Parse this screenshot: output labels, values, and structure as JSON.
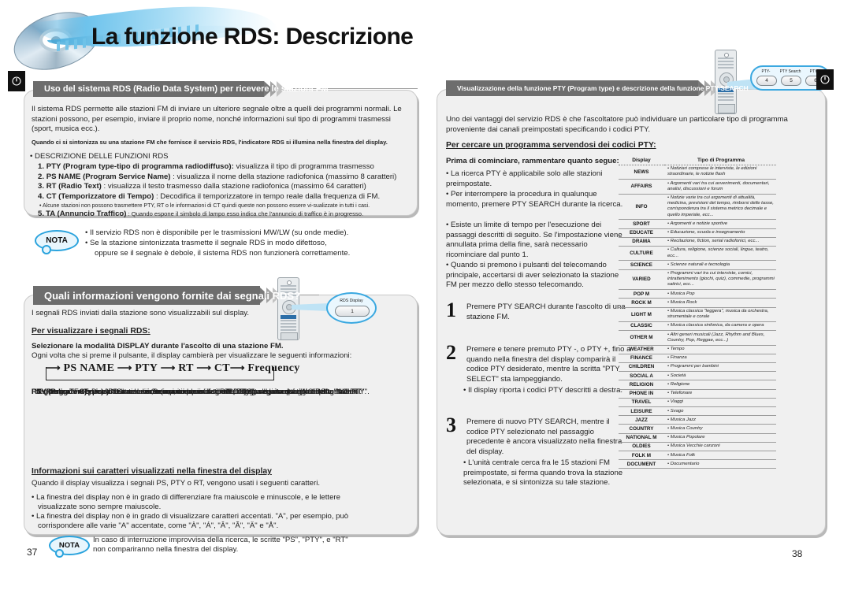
{
  "document": {
    "title": "La funzione RDS: Descrizione",
    "left_page_number": "37",
    "right_page_number": "38"
  },
  "left_page": {
    "section1": {
      "banner": "Uso del sistema RDS (Radio Data System) per ricevere le stazioni FM",
      "intro": "Il sistema RDS permette alle stazioni FM di inviare un ulteriore segnale oltre a quelli dei programmi normali. Le stazioni possono, per esempio, inviare il proprio nome, nonché informazioni sul tipo di programmi trasmessi (sport, musica ecc.).",
      "bold_note": "Quando ci si sintonizza su una stazione FM che fornisce il servizio RDS, l'indicatore RDS si illumina nella finestra del display.",
      "list_title": "• DESCRIZIONE DELLE FUNZIONI RDS",
      "items": [
        {
          "num": "1.",
          "bold": "PTY (Program type-tipo di programma radiodiffuso):",
          "rest": " visualizza il tipo di programma trasmesso"
        },
        {
          "num": "2.",
          "bold": "PS NAME (Program Service Name)",
          "rest": " : visualizza il nome della stazione radiofonica (massimo 8 caratteri)"
        },
        {
          "num": "3.",
          "bold": "RT (Radio Text)",
          "rest": " : visualizza il testo trasmesso dalla stazione radiofonica (massimo 64 caratteri)"
        },
        {
          "num": "4.",
          "bold": "CT (Temporizzatore di Tempo)",
          "rest": " : Decodifica il temporizzatore in tempo reale dalla frequenza di FM."
        }
      ],
      "sub_note": "• Alcune stazioni non possono trasmettere PTY, RT o le informazioni di CT quindi queste non possono essere vi-sualizzate in tutti i casi.",
      "item5_num": "5.",
      "item5_bold": "TA (Annuncio Traffico)",
      "item5_rest": " : Quando espone il simbolo di lampo esso indica che l'annuncio di traffico è in progresso."
    },
    "nota1": {
      "label": "NOTA",
      "line1": "• Il servizio RDS non è disponibile per le trasmissioni MW/LW (su onde medie).",
      "line2": "• Se la stazione sintonizzata trasmette il segnale RDS in modo difettoso,",
      "line3": "oppure se il segnale è debole, il sistema RDS non funzionerà correttamente."
    },
    "section2": {
      "banner": "Quali informazioni vengono fornite dai segnali RDS?",
      "intro": "I segnali RDS inviati dalla stazione sono visualizzabili sul display.",
      "subtitle": "Per visualizzare i segnali RDS:",
      "bold_line": "Selezionare la modalità DISPLAY durante l'ascolto di una stazione FM.",
      "normal_line": "Ogni volta che si preme il pulsante,  il display cambierà per visualizzare le seguenti informazioni:",
      "flow": [
        "PS NAME",
        "PTY",
        "RT",
        "CT",
        "Frequency"
      ],
      "defs": [
        {
          "bold": "PS (Program Service):",
          "rest": " Durante la ricerca, compare la scritta \"PS\", seguita dai nomi delle stazioni.",
          "cont": "Se non viene inviato alcun segnale, compare la scritta \"NO PS\"."
        },
        {
          "bold": "PTY (Program Type):",
          "rest": " Durante la ricerca, compare la scritta \"PTY\", seguita dal tipo di programma",
          "cont": "trasmesso. Se non viene inviato alcun segnale, compare la scritta \"NO PTY\"."
        },
        {
          "bold": "RT (Radio Text):",
          "rest": " Durante la ricerca, compare la scritta \"RT\", seguita dai messaggi di testo inviati",
          "cont": "dalla stazione. Se non viene inviato alcun segnale, compare la scritta \"NO RT\"."
        },
        {
          "bold": "Frequenza:",
          "rest": " Frequenza della stazione (servizio non di tipo RDS).",
          "cont": ""
        }
      ],
      "chars_title": "Informazioni sui caratteri visualizzati nella finestra del display",
      "chars_intro": "Quando il display visualizza i segnali PS, PTY o RT, vengono usati i seguenti caratteri.",
      "chars_b1_l1": "• La finestra del display non è in grado di differenziare fra maiuscole e minuscole, e le lettere",
      "chars_b1_l2": "visualizzate sono sempre maiuscole.",
      "chars_b2_l1": "• La finestra del display non è in grado di visualizzare caratteri accentati. \"A\", per esempio, può",
      "chars_b2_l2": "corrispondere alle varie \"A\" accentate, come \"À\", \"Á\", \"Â\", \"Ã\", \"Ä\" e \"Å\"."
    },
    "nota2": {
      "label": "NOTA",
      "line1": "In caso di interruzione improvvisa della ricerca, le scritte \"PS\", \"PTY\", e \"RT\"",
      "line2": "non compariranno nella finestra del display."
    },
    "remote_callout": {
      "button_label": "RDS Display",
      "button_number": "1"
    }
  },
  "right_page": {
    "banner": "Visualizzazione della funzione PTY (Program type) e descrizione della funzione PTY-SEARCH",
    "intro": "Uno dei vantaggi del servizio RDS è che l'ascoltatore può individuare un particolare tipo di programma proveniente dai canali preimpostati specificando i codici PTY.",
    "subtitle": "Per cercare un programma servendosi dei codici PTY:",
    "before_title": "Prima di cominciare, rammentare quanto segue:",
    "before_bullets": [
      "• La ricerca PTY è applicabile solo alle stazioni preimpostate.",
      "• Per interrompere la procedura in qualunque momento, premere PTY SEARCH durante la ricerca.",
      "• Esiste un limite di tempo per l'esecuzione dei passaggi descritti di seguito. Se l'impostazione viene annullata prima della fine, sarà necessario ricominciare dal punto 1.",
      "• Quando si premono i pulsanti del telecomando principale, accertarsi di aver selezionato la stazione FM per mezzo dello stesso telecomando."
    ],
    "steps": [
      {
        "num": "1",
        "text": "Premere PTY SEARCH durante l'ascolto di una stazione FM.",
        "sub": ""
      },
      {
        "num": "2",
        "text": "Premere e tenere premuto PTY -, o PTY +, fino a quando nella finestra del display comparirà il codice PTY desiderato, mentre la scritta \"PTY SELECT\" sta lampeggiando.",
        "sub": "• Il display riporta i codici PTY descritti a destra."
      },
      {
        "num": "3",
        "text": "Premere di nuovo PTY SEARCH, mentre il codice PTY selezionato nel passaggio precedente è ancora visualizzato nella finestra del display.",
        "sub": "• L'unità centrale cerca fra le 15 stazioni FM preimpostate, si ferma quando trova la stazione selezionata, e si sintonizza su tale stazione."
      }
    ],
    "remote_callout": {
      "buttons": [
        {
          "label": "PTY-",
          "number": "4"
        },
        {
          "label": "PTY Search",
          "number": "5"
        },
        {
          "label": "PTY+",
          "number": "6"
        }
      ]
    },
    "pty_table": {
      "headers": [
        "Display",
        "Tipo di Programma"
      ],
      "rows": [
        {
          "code": "NEWS",
          "desc": "• Notiziari comprese le interviste, le edizioni straordinarie, le notizie flash"
        },
        {
          "code": "AFFAIRS",
          "desc": "• Argomenti vari tra cui avvenimenti, documentari, analisi, discussioni e forum"
        },
        {
          "code": "INFO",
          "desc": "• Notizie varie tra cui argomenti di attualità, medicina, previsioni del tempo, rimborsi delle tasse, corrispondenza tra il sistema  metrico decimale e quello imperiale, ecc..."
        },
        {
          "code": "SPORT",
          "desc": "• Argomenti e notizie sportive"
        },
        {
          "code": "EDUCATE",
          "desc": "• Educazione, scuola e insegnamento"
        },
        {
          "code": "DRAMA",
          "desc": "• Recitazione, fiction, serial radiofonici, ecc..."
        },
        {
          "code": "CULTURE",
          "desc": "• Cultura, religione, scienze sociali, lingue, teatro, ecc..."
        },
        {
          "code": "SCIENCE",
          "desc": "• Scienze naturali e tecnologia"
        },
        {
          "code": "VARIED",
          "desc": "• Programmi vari tra cui interviste, comici, intrattenimento (giochi, quiz), commedie, programmi satirici, ecc..."
        },
        {
          "code": "POP M",
          "desc": "• Musica Pop"
        },
        {
          "code": "ROCK M",
          "desc": "• Musica Rock"
        },
        {
          "code": "LIGHT M",
          "desc": "• Musica classica \"leggera\", musica da orchestra, strumentale e corale"
        },
        {
          "code": "CLASSIC",
          "desc": "• Musica classica sinfonica, da camera e opera"
        },
        {
          "code": "OTHER M",
          "desc": "• Altri generi musicali (Jazz, Rhythm and Blues, Country, Pop, Reggae, ecc...)"
        },
        {
          "code": "WEATHER",
          "desc": "• Tempo"
        },
        {
          "code": "FINANCE",
          "desc": "• Finanza"
        },
        {
          "code": "CHILDREN",
          "desc": "• Programmi per bambini"
        },
        {
          "code": "SOCIAL A",
          "desc": "• Società"
        },
        {
          "code": "RELIGION",
          "desc": "• Religione"
        },
        {
          "code": "PHONE IN",
          "desc": "• Telefonare"
        },
        {
          "code": "TRAVEL",
          "desc": "• Viaggi"
        },
        {
          "code": "LEISURE",
          "desc": "• Svago"
        },
        {
          "code": "JAZZ",
          "desc": "• Musica Jazz"
        },
        {
          "code": "COUNTRY",
          "desc": "• Musica Country"
        },
        {
          "code": "NATIONAL M",
          "desc": "• Musica Popolare"
        },
        {
          "code": "OLDIES",
          "desc": "• Musica Vecchie canzoni"
        },
        {
          "code": "FOLK M",
          "desc": "• Musica Folk"
        },
        {
          "code": "DOCUMENT",
          "desc": "• Documentario"
        }
      ]
    }
  }
}
